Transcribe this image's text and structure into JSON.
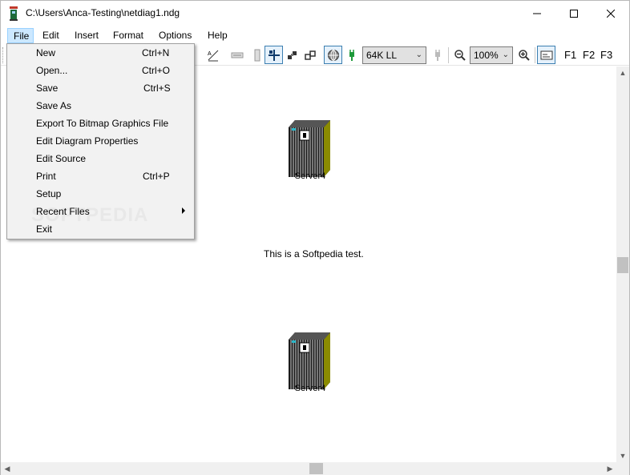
{
  "window": {
    "title": "C:\\Users\\Anca-Testing\\netdiag1.ndg",
    "minimize_glyph": "—",
    "maximize_glyph": "☐",
    "close_glyph": "✕"
  },
  "menubar": {
    "items": [
      {
        "label": "File",
        "active": true
      },
      {
        "label": "Edit"
      },
      {
        "label": "Insert"
      },
      {
        "label": "Format"
      },
      {
        "label": "Options"
      },
      {
        "label": "Help"
      }
    ]
  },
  "toolbar": {
    "speed_combo": "64K LL",
    "zoom_combo": "100%",
    "fkeys": [
      "F1",
      "F2",
      "F3"
    ],
    "combo_arrow": "⌄"
  },
  "file_menu": {
    "items": [
      {
        "label": "New",
        "shortcut": "Ctrl+N"
      },
      {
        "label": "Open...",
        "shortcut": "Ctrl+O"
      },
      {
        "label": "Save",
        "shortcut": "Ctrl+S"
      },
      {
        "label": "Save As",
        "shortcut": ""
      },
      {
        "label": "Export To Bitmap Graphics File",
        "shortcut": ""
      },
      {
        "label": "Edit Diagram Properties",
        "shortcut": ""
      },
      {
        "label": "Edit Source",
        "shortcut": ""
      },
      {
        "label": "Print",
        "shortcut": "Ctrl+P"
      },
      {
        "label": "Setup",
        "shortcut": ""
      },
      {
        "label": "Recent Files",
        "shortcut": "",
        "submenu": true
      },
      {
        "label": "Exit",
        "shortcut": ""
      }
    ]
  },
  "canvas": {
    "nodes": [
      {
        "label": "Server4"
      },
      {
        "label": "Server4"
      }
    ],
    "text_note": "This is a Softpedia test.",
    "watermark": "SOFTPEDIA"
  },
  "colors": {
    "menu_highlight": "#cce8ff",
    "pressed_border": "#3c7fb1",
    "server_side": "#8b8b00",
    "server_front": "#1a1a1a"
  },
  "icons": {
    "scroll_up": "▲",
    "scroll_down": "▼",
    "scroll_left": "◀",
    "scroll_right": "▶"
  }
}
